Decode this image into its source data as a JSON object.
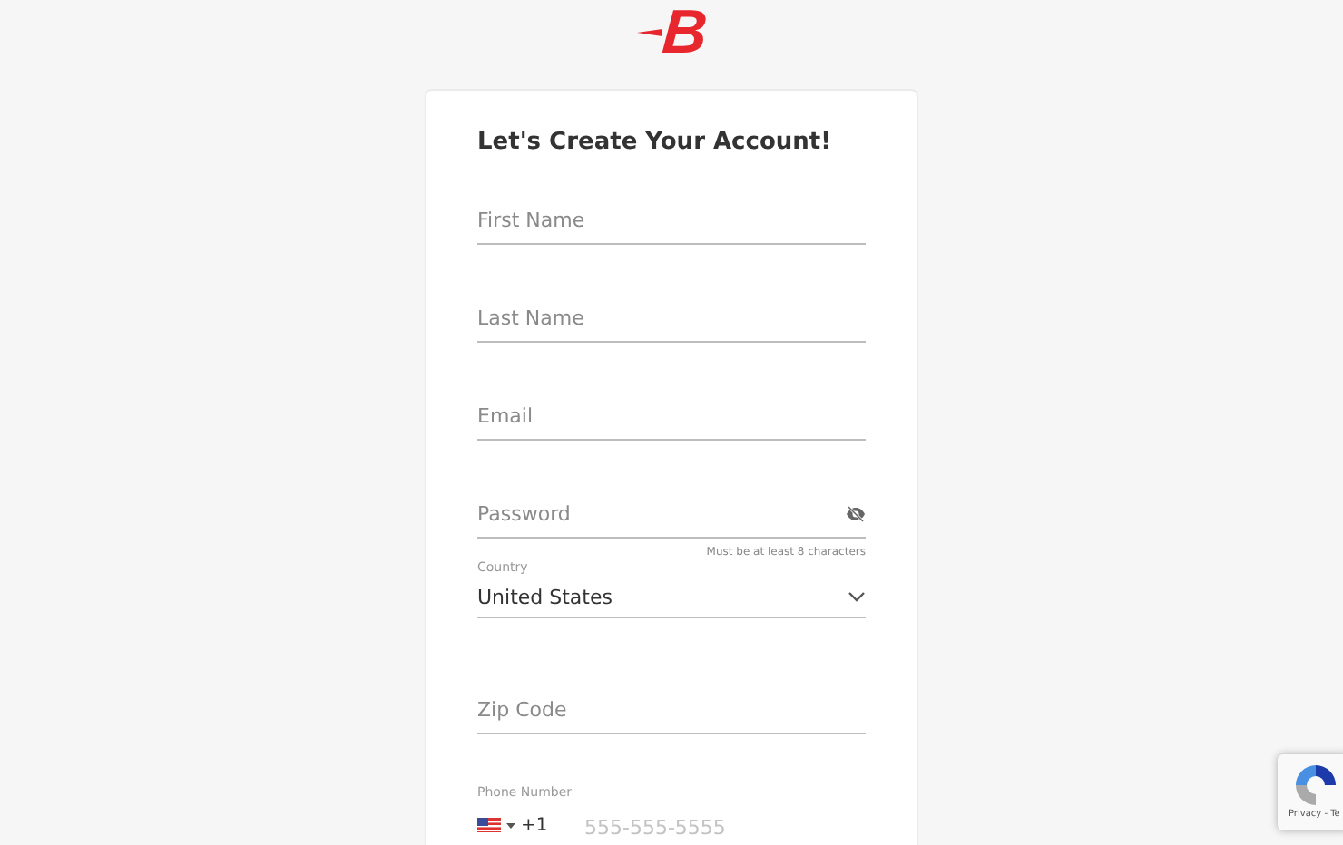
{
  "logo": {
    "text": "B"
  },
  "form": {
    "title": "Let's Create Your Account!",
    "fields": [
      {
        "kind": "text",
        "placeholder": "First Name"
      },
      {
        "kind": "text",
        "placeholder": "Last Name"
      },
      {
        "kind": "text",
        "placeholder": "Email"
      },
      {
        "kind": "password",
        "placeholder": "Password",
        "hint": "Must be at least 8 characters"
      },
      {
        "kind": "select",
        "label": "Country",
        "value": "United States"
      },
      {
        "kind": "text",
        "placeholder": "Zip Code"
      },
      {
        "kind": "phone",
        "label": "Phone Number",
        "code": "+1",
        "placeholder": "555-555-5555"
      }
    ]
  },
  "recaptcha": {
    "text": "Privacy - Te"
  }
}
